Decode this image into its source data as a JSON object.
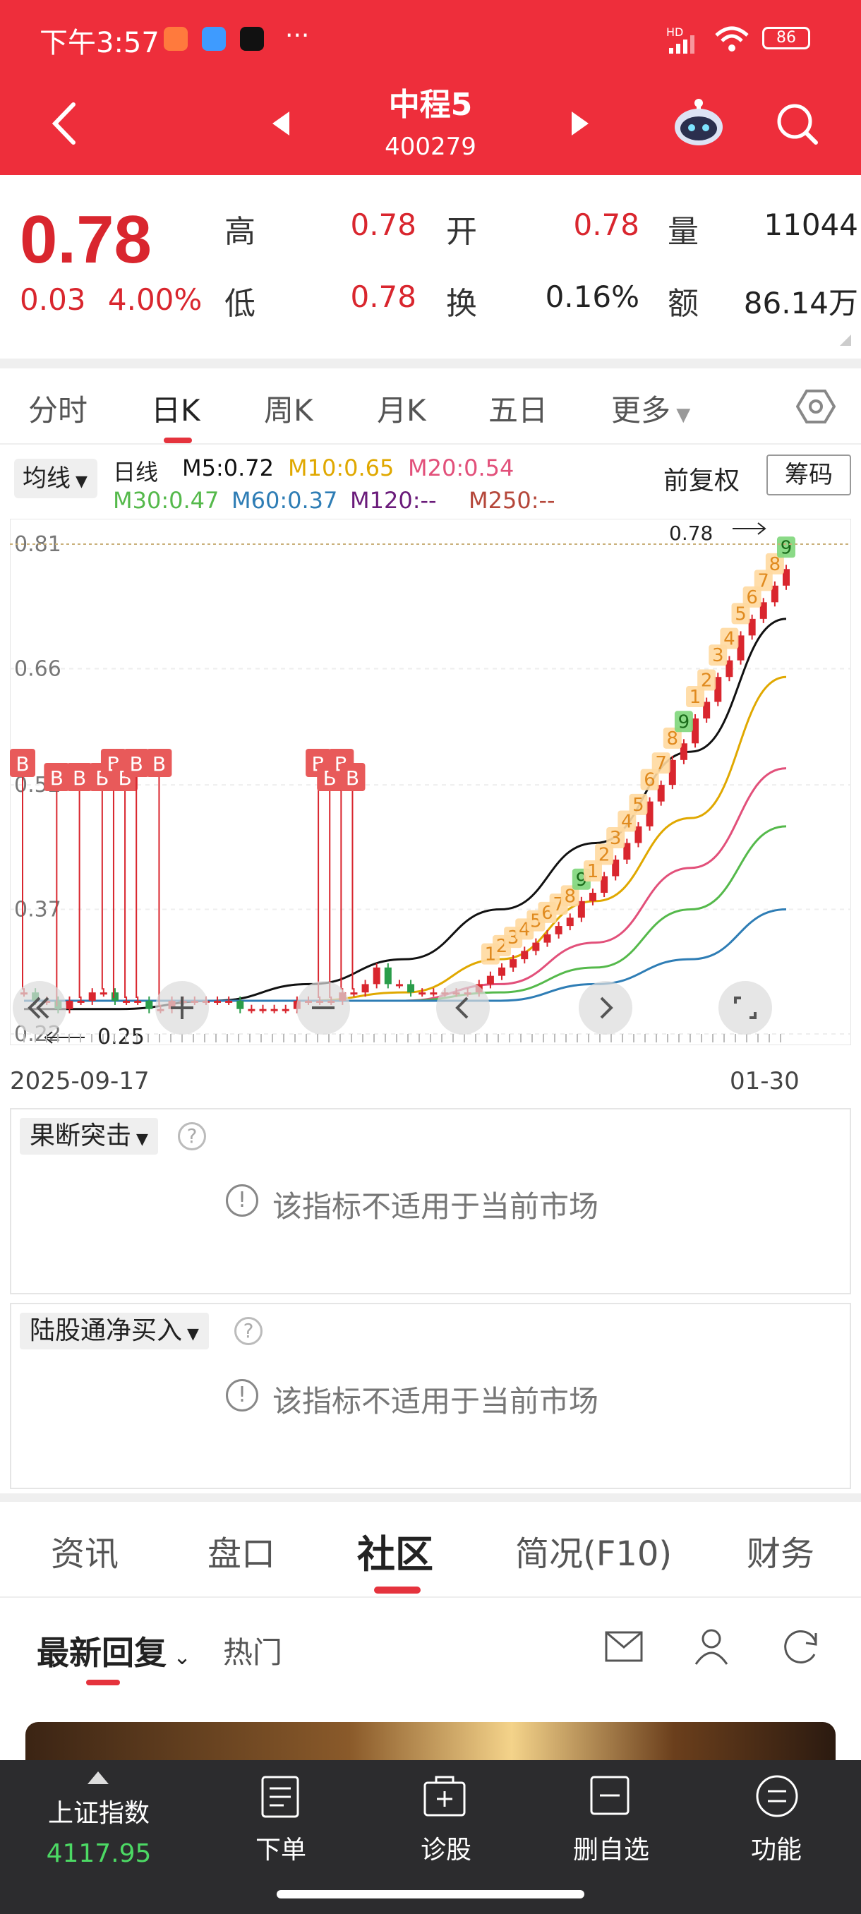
{
  "status_bar": {
    "time": "下午3:57",
    "dots": "···",
    "network": "HD",
    "battery": "86"
  },
  "header": {
    "name": "中程5",
    "code": "400279"
  },
  "quote": {
    "price": "0.78",
    "change": "0.03",
    "change_pct": "4.00%",
    "high_label": "高",
    "high": "0.78",
    "open_label": "开",
    "open": "0.78",
    "volume_label": "量",
    "volume": "11044",
    "low_label": "低",
    "low": "0.78",
    "turnover_label": "换",
    "turnover": "0.16%",
    "amount_label": "额",
    "amount": "86.14万"
  },
  "period_tabs": [
    "分时",
    "日K",
    "周K",
    "月K",
    "五日",
    "更多"
  ],
  "legend": {
    "avg_btn": "均线",
    "day": "日线",
    "m5": "M5:0.72",
    "m10": "M10:0.65",
    "m20": "M20:0.54",
    "m30": "M30:0.47",
    "m60": "M60:0.37",
    "m120": "M120:--",
    "m250": "M250:--",
    "adjust": "前复权",
    "chips": "筹码"
  },
  "colors": {
    "brand_red": "#EE2E3B",
    "up_red": "#D9262E",
    "m5": "#111111",
    "m10": "#E0A800",
    "m20": "#E2507A",
    "m30": "#55B94B",
    "m60": "#2E7DB5",
    "m120": "#6A1B7A",
    "m250": "#B5473A"
  },
  "chart_data": {
    "type": "candlestick",
    "y_ticks": [
      "0.81",
      "0.66",
      "0.52",
      "0.37",
      "0.22"
    ],
    "ylim": [
      0.22,
      0.81
    ],
    "x_start": "2025-09-17",
    "x_end": "01-30",
    "high_mark": "0.78",
    "low_mark": "0.25",
    "closes": [
      0.27,
      0.26,
      0.26,
      0.25,
      0.26,
      0.26,
      0.27,
      0.27,
      0.26,
      0.26,
      0.26,
      0.25,
      0.25,
      0.26,
      0.26,
      0.26,
      0.26,
      0.26,
      0.26,
      0.25,
      0.25,
      0.25,
      0.25,
      0.25,
      0.26,
      0.26,
      0.26,
      0.26,
      0.27,
      0.27,
      0.28,
      0.3,
      0.28,
      0.28,
      0.27,
      0.27,
      0.27,
      0.27,
      0.27,
      0.27,
      0.28,
      0.29,
      0.3,
      0.31,
      0.32,
      0.33,
      0.34,
      0.35,
      0.36,
      0.38,
      0.39,
      0.41,
      0.43,
      0.45,
      0.47,
      0.5,
      0.52,
      0.55,
      0.57,
      0.6,
      0.62,
      0.65,
      0.67,
      0.7,
      0.72,
      0.74,
      0.76,
      0.78
    ],
    "ma": [
      {
        "name": "M5",
        "values": [
          0.25,
          0.25,
          0.26,
          0.28,
          0.31,
          0.37,
          0.45,
          0.56,
          0.72
        ]
      },
      {
        "name": "M10",
        "values": [
          0.26,
          0.26,
          0.26,
          0.26,
          0.27,
          0.31,
          0.38,
          0.48,
          0.65
        ]
      },
      {
        "name": "M20",
        "values": [
          0.26,
          0.26,
          0.26,
          0.26,
          0.26,
          0.28,
          0.33,
          0.42,
          0.54
        ]
      },
      {
        "name": "M30",
        "values": [
          0.26,
          0.26,
          0.26,
          0.26,
          0.26,
          0.27,
          0.3,
          0.37,
          0.47
        ]
      },
      {
        "name": "M60",
        "values": [
          0.26,
          0.26,
          0.26,
          0.26,
          0.26,
          0.26,
          0.28,
          0.31,
          0.37
        ]
      }
    ],
    "buy_signal_label": "B",
    "td_counts": [
      "1",
      "2",
      "3",
      "4",
      "5",
      "6",
      "7",
      "8",
      "9",
      "1",
      "2",
      "3",
      "4",
      "5",
      "6",
      "7",
      "8",
      "9",
      "1",
      "2",
      "3",
      "4",
      "5",
      "6",
      "7",
      "8",
      "9"
    ]
  },
  "panels": [
    {
      "title": "果断突击",
      "message": "该指标不适用于当前市场"
    },
    {
      "title": "陆股通净买入",
      "message": "该指标不适用于当前市场"
    }
  ],
  "bottom_tabs": [
    "资讯",
    "盘口",
    "社区",
    "简况(F10)",
    "财务"
  ],
  "community": {
    "sort": "最新回复",
    "hot": "热门"
  },
  "bottom_nav": {
    "index_name": "上证指数",
    "index_value": "4117.95",
    "order": "下单",
    "diagnose": "诊股",
    "remove": "删自选",
    "functions": "功能"
  }
}
